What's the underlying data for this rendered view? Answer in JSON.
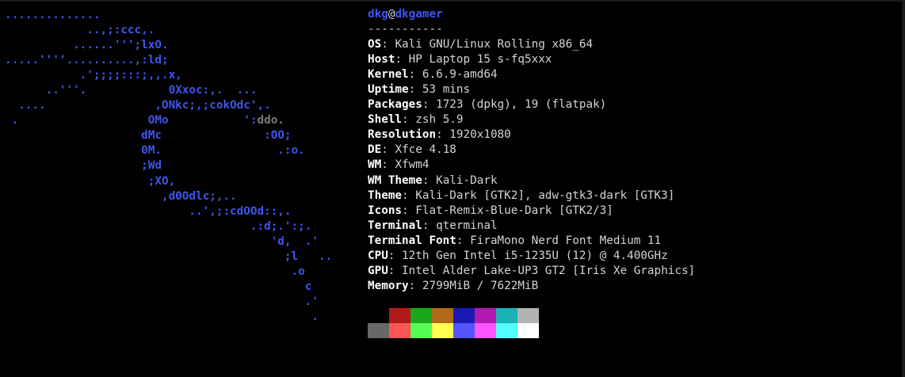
{
  "window": {
    "ascii_logo_lines": [
      "..............",
      "            ..,;:ccc,.",
      "          ......''';lxO.",
      ".....''''..........,:ld;",
      "           .';;;;:::;,,.x,",
      "      ..'''.            0Xxoc:,.  ...",
      "  ....                ,ONkc;,;cokOdc',.",
      " .                   OMo           ':",
      "                    dMc               :OO;",
      "                    0M.                 .:o.",
      "                    ;Wd",
      "                     ;XO,",
      "                       ,d0Odlc;,..",
      "                           ..',;:cdOOd::,.",
      "                                    .:d;.':;.",
      "                                       'd,  .'",
      "                                         ;l   ..",
      "                                          .o",
      "                                            c",
      "                                            .'",
      "                                             ."
    ],
    "ascii_logo_dim_fragment": "ddo.",
    "user": "dkg",
    "at_sign": "@",
    "host": "dkgamer",
    "separator": "-----------",
    "info": [
      {
        "key": "OS",
        "value": "Kali GNU/Linux Rolling x86_64"
      },
      {
        "key": "Host",
        "value": "HP Laptop 15 s-fq5xxx"
      },
      {
        "key": "Kernel",
        "value": "6.6.9-amd64"
      },
      {
        "key": "Uptime",
        "value": "53 mins"
      },
      {
        "key": "Packages",
        "value": "1723 (dpkg), 19 (flatpak)"
      },
      {
        "key": "Shell",
        "value": "zsh 5.9"
      },
      {
        "key": "Resolution",
        "value": "1920x1080"
      },
      {
        "key": "DE",
        "value": "Xfce 4.18"
      },
      {
        "key": "WM",
        "value": "Xfwm4"
      },
      {
        "key": "WM Theme",
        "value": "Kali-Dark"
      },
      {
        "key": "Theme",
        "value": "Kali-Dark [GTK2], adw-gtk3-dark [GTK3]"
      },
      {
        "key": "Icons",
        "value": "Flat-Remix-Blue-Dark [GTK2/3]"
      },
      {
        "key": "Terminal",
        "value": "qterminal"
      },
      {
        "key": "Terminal Font",
        "value": "FiraMono Nerd Font Medium 11"
      },
      {
        "key": "CPU",
        "value": "12th Gen Intel i5-1235U (12) @ 4.400GHz"
      },
      {
        "key": "GPU",
        "value": "Intel Alder Lake-UP3 GT2 [Iris Xe Graphics]"
      },
      {
        "key": "Memory",
        "value": "2799MiB / 7622MiB"
      }
    ],
    "colors": {
      "background": "#000000",
      "logo": "#3e56f0",
      "text": "#d4d4d4",
      "key": "#ffffff"
    },
    "palette_normal": [
      "#000000",
      "#b21a1a",
      "#1aa81a",
      "#b06a1a",
      "#1a1ab2",
      "#b21ab2",
      "#1ab2b2",
      "#b2b2b2"
    ],
    "palette_bright": [
      "#686868",
      "#ff5454",
      "#54ff54",
      "#ffff54",
      "#5454ff",
      "#ff54ff",
      "#54ffff",
      "#ffffff"
    ]
  }
}
